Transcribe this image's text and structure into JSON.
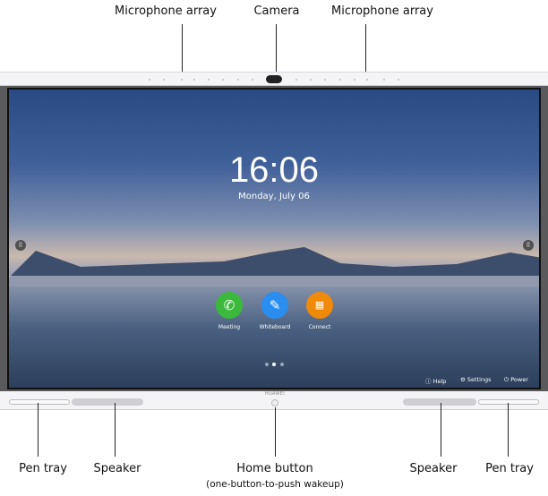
{
  "callouts_top": {
    "mic_left": "Microphone array",
    "camera": "Camera",
    "mic_right": "Microphone array"
  },
  "callouts_bottom": {
    "pen_tray_left": "Pen tray",
    "speaker_left": "Speaker",
    "home_button": "Home button",
    "home_button_note": "(one-button-to-push wakeup)",
    "speaker_right": "Speaker",
    "pen_tray_right": "Pen tray"
  },
  "screen": {
    "time": "16:06",
    "date": "Monday, July 06",
    "apps": [
      {
        "label": "Meeting",
        "icon": "phone-icon",
        "color": "#3cb93c"
      },
      {
        "label": "Whiteboard",
        "icon": "pen-icon",
        "color": "#2a8ef0"
      },
      {
        "label": "Connect",
        "icon": "screen-share-icon",
        "color": "#f08a0a"
      }
    ],
    "page_indicator": {
      "pages": 3,
      "current": 2
    },
    "utilities": [
      {
        "label": "Help",
        "icon": "help-icon"
      },
      {
        "label": "Settings",
        "icon": "gear-icon"
      },
      {
        "label": "Power",
        "icon": "power-icon"
      }
    ]
  },
  "brand": "HUAWEI"
}
